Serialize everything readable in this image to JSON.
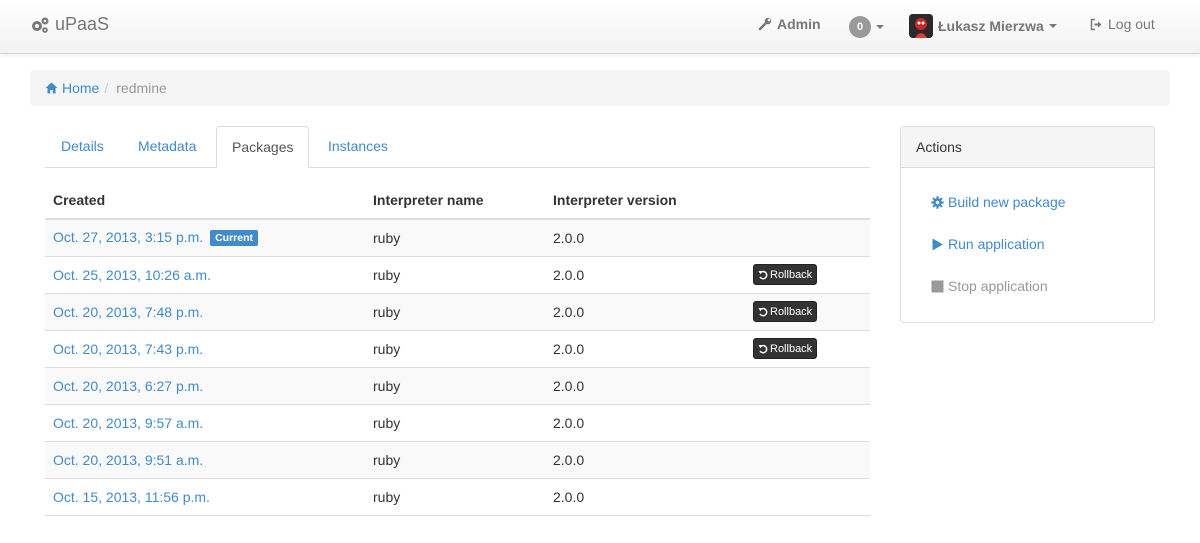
{
  "navbar": {
    "brand": "uPaaS",
    "admin_label": "Admin",
    "notifications_count": "0",
    "user_name": "Łukasz Mierzwa",
    "logout_label": "Log out"
  },
  "breadcrumb": {
    "home": "Home",
    "current": "redmine"
  },
  "tabs": [
    {
      "label": "Details"
    },
    {
      "label": "Metadata"
    },
    {
      "label": "Packages"
    },
    {
      "label": "Instances"
    }
  ],
  "table": {
    "headers": [
      "Created",
      "Interpreter name",
      "Interpreter version"
    ],
    "current_label": "Current",
    "rollback_label": "Rollback",
    "rows": [
      {
        "created": "Oct. 27, 2013, 3:15 p.m.",
        "name": "ruby",
        "version": "2.0.0"
      },
      {
        "created": "Oct. 25, 2013, 10:26 a.m.",
        "name": "ruby",
        "version": "2.0.0"
      },
      {
        "created": "Oct. 20, 2013, 7:48 p.m.",
        "name": "ruby",
        "version": "2.0.0"
      },
      {
        "created": "Oct. 20, 2013, 7:43 p.m.",
        "name": "ruby",
        "version": "2.0.0"
      },
      {
        "created": "Oct. 20, 2013, 6:27 p.m.",
        "name": "ruby",
        "version": "2.0.0"
      },
      {
        "created": "Oct. 20, 2013, 9:57 a.m.",
        "name": "ruby",
        "version": "2.0.0"
      },
      {
        "created": "Oct. 20, 2013, 9:51 a.m.",
        "name": "ruby",
        "version": "2.0.0"
      },
      {
        "created": "Oct. 15, 2013, 11:56 p.m.",
        "name": "ruby",
        "version": "2.0.0"
      }
    ]
  },
  "actions": {
    "title": "Actions",
    "build": "Build new package",
    "run": "Run application",
    "stop": "Stop application"
  },
  "colors": {
    "link": "#428bca",
    "current_label": "#428bca",
    "rollback_button": "#333333",
    "disabled": "#999999"
  },
  "icons": {
    "brand": "cogs-icon",
    "admin": "wrench-icon",
    "logout": "logout-icon",
    "home": "home-icon",
    "build": "gear-icon",
    "run": "play-icon",
    "stop": "stop-icon",
    "rollback": "undo-icon"
  }
}
